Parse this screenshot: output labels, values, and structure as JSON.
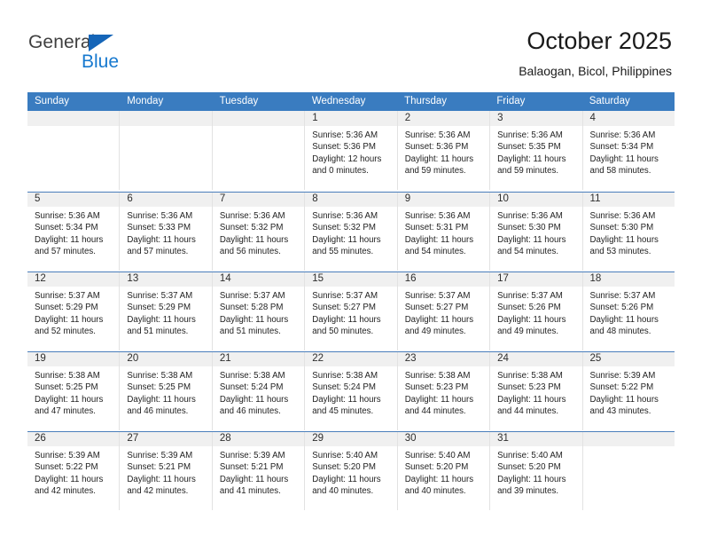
{
  "brand": {
    "name_top": "General",
    "name_bottom": "Blue",
    "accent_color": "#1779cf",
    "triangle_color": "#1565b8"
  },
  "header": {
    "title": "October 2025",
    "subtitle": "Balaogan, Bicol, Philippines"
  },
  "theme": {
    "header_row_bg": "#3a7cc0",
    "header_row_text": "#ffffff",
    "daynum_band_bg": "#f0f0f0",
    "week_separator": "#4a7ebb",
    "cell_border": "#e2e2e2"
  },
  "weekdays": [
    "Sunday",
    "Monday",
    "Tuesday",
    "Wednesday",
    "Thursday",
    "Friday",
    "Saturday"
  ],
  "weeks": [
    [
      {
        "day": "",
        "lines": []
      },
      {
        "day": "",
        "lines": []
      },
      {
        "day": "",
        "lines": []
      },
      {
        "day": "1",
        "lines": [
          "Sunrise: 5:36 AM",
          "Sunset: 5:36 PM",
          "Daylight: 12 hours",
          "and 0 minutes."
        ]
      },
      {
        "day": "2",
        "lines": [
          "Sunrise: 5:36 AM",
          "Sunset: 5:36 PM",
          "Daylight: 11 hours",
          "and 59 minutes."
        ]
      },
      {
        "day": "3",
        "lines": [
          "Sunrise: 5:36 AM",
          "Sunset: 5:35 PM",
          "Daylight: 11 hours",
          "and 59 minutes."
        ]
      },
      {
        "day": "4",
        "lines": [
          "Sunrise: 5:36 AM",
          "Sunset: 5:34 PM",
          "Daylight: 11 hours",
          "and 58 minutes."
        ]
      }
    ],
    [
      {
        "day": "5",
        "lines": [
          "Sunrise: 5:36 AM",
          "Sunset: 5:34 PM",
          "Daylight: 11 hours",
          "and 57 minutes."
        ]
      },
      {
        "day": "6",
        "lines": [
          "Sunrise: 5:36 AM",
          "Sunset: 5:33 PM",
          "Daylight: 11 hours",
          "and 57 minutes."
        ]
      },
      {
        "day": "7",
        "lines": [
          "Sunrise: 5:36 AM",
          "Sunset: 5:32 PM",
          "Daylight: 11 hours",
          "and 56 minutes."
        ]
      },
      {
        "day": "8",
        "lines": [
          "Sunrise: 5:36 AM",
          "Sunset: 5:32 PM",
          "Daylight: 11 hours",
          "and 55 minutes."
        ]
      },
      {
        "day": "9",
        "lines": [
          "Sunrise: 5:36 AM",
          "Sunset: 5:31 PM",
          "Daylight: 11 hours",
          "and 54 minutes."
        ]
      },
      {
        "day": "10",
        "lines": [
          "Sunrise: 5:36 AM",
          "Sunset: 5:30 PM",
          "Daylight: 11 hours",
          "and 54 minutes."
        ]
      },
      {
        "day": "11",
        "lines": [
          "Sunrise: 5:36 AM",
          "Sunset: 5:30 PM",
          "Daylight: 11 hours",
          "and 53 minutes."
        ]
      }
    ],
    [
      {
        "day": "12",
        "lines": [
          "Sunrise: 5:37 AM",
          "Sunset: 5:29 PM",
          "Daylight: 11 hours",
          "and 52 minutes."
        ]
      },
      {
        "day": "13",
        "lines": [
          "Sunrise: 5:37 AM",
          "Sunset: 5:29 PM",
          "Daylight: 11 hours",
          "and 51 minutes."
        ]
      },
      {
        "day": "14",
        "lines": [
          "Sunrise: 5:37 AM",
          "Sunset: 5:28 PM",
          "Daylight: 11 hours",
          "and 51 minutes."
        ]
      },
      {
        "day": "15",
        "lines": [
          "Sunrise: 5:37 AM",
          "Sunset: 5:27 PM",
          "Daylight: 11 hours",
          "and 50 minutes."
        ]
      },
      {
        "day": "16",
        "lines": [
          "Sunrise: 5:37 AM",
          "Sunset: 5:27 PM",
          "Daylight: 11 hours",
          "and 49 minutes."
        ]
      },
      {
        "day": "17",
        "lines": [
          "Sunrise: 5:37 AM",
          "Sunset: 5:26 PM",
          "Daylight: 11 hours",
          "and 49 minutes."
        ]
      },
      {
        "day": "18",
        "lines": [
          "Sunrise: 5:37 AM",
          "Sunset: 5:26 PM",
          "Daylight: 11 hours",
          "and 48 minutes."
        ]
      }
    ],
    [
      {
        "day": "19",
        "lines": [
          "Sunrise: 5:38 AM",
          "Sunset: 5:25 PM",
          "Daylight: 11 hours",
          "and 47 minutes."
        ]
      },
      {
        "day": "20",
        "lines": [
          "Sunrise: 5:38 AM",
          "Sunset: 5:25 PM",
          "Daylight: 11 hours",
          "and 46 minutes."
        ]
      },
      {
        "day": "21",
        "lines": [
          "Sunrise: 5:38 AM",
          "Sunset: 5:24 PM",
          "Daylight: 11 hours",
          "and 46 minutes."
        ]
      },
      {
        "day": "22",
        "lines": [
          "Sunrise: 5:38 AM",
          "Sunset: 5:24 PM",
          "Daylight: 11 hours",
          "and 45 minutes."
        ]
      },
      {
        "day": "23",
        "lines": [
          "Sunrise: 5:38 AM",
          "Sunset: 5:23 PM",
          "Daylight: 11 hours",
          "and 44 minutes."
        ]
      },
      {
        "day": "24",
        "lines": [
          "Sunrise: 5:38 AM",
          "Sunset: 5:23 PM",
          "Daylight: 11 hours",
          "and 44 minutes."
        ]
      },
      {
        "day": "25",
        "lines": [
          "Sunrise: 5:39 AM",
          "Sunset: 5:22 PM",
          "Daylight: 11 hours",
          "and 43 minutes."
        ]
      }
    ],
    [
      {
        "day": "26",
        "lines": [
          "Sunrise: 5:39 AM",
          "Sunset: 5:22 PM",
          "Daylight: 11 hours",
          "and 42 minutes."
        ]
      },
      {
        "day": "27",
        "lines": [
          "Sunrise: 5:39 AM",
          "Sunset: 5:21 PM",
          "Daylight: 11 hours",
          "and 42 minutes."
        ]
      },
      {
        "day": "28",
        "lines": [
          "Sunrise: 5:39 AM",
          "Sunset: 5:21 PM",
          "Daylight: 11 hours",
          "and 41 minutes."
        ]
      },
      {
        "day": "29",
        "lines": [
          "Sunrise: 5:40 AM",
          "Sunset: 5:20 PM",
          "Daylight: 11 hours",
          "and 40 minutes."
        ]
      },
      {
        "day": "30",
        "lines": [
          "Sunrise: 5:40 AM",
          "Sunset: 5:20 PM",
          "Daylight: 11 hours",
          "and 40 minutes."
        ]
      },
      {
        "day": "31",
        "lines": [
          "Sunrise: 5:40 AM",
          "Sunset: 5:20 PM",
          "Daylight: 11 hours",
          "and 39 minutes."
        ]
      },
      {
        "day": "",
        "lines": []
      }
    ]
  ]
}
